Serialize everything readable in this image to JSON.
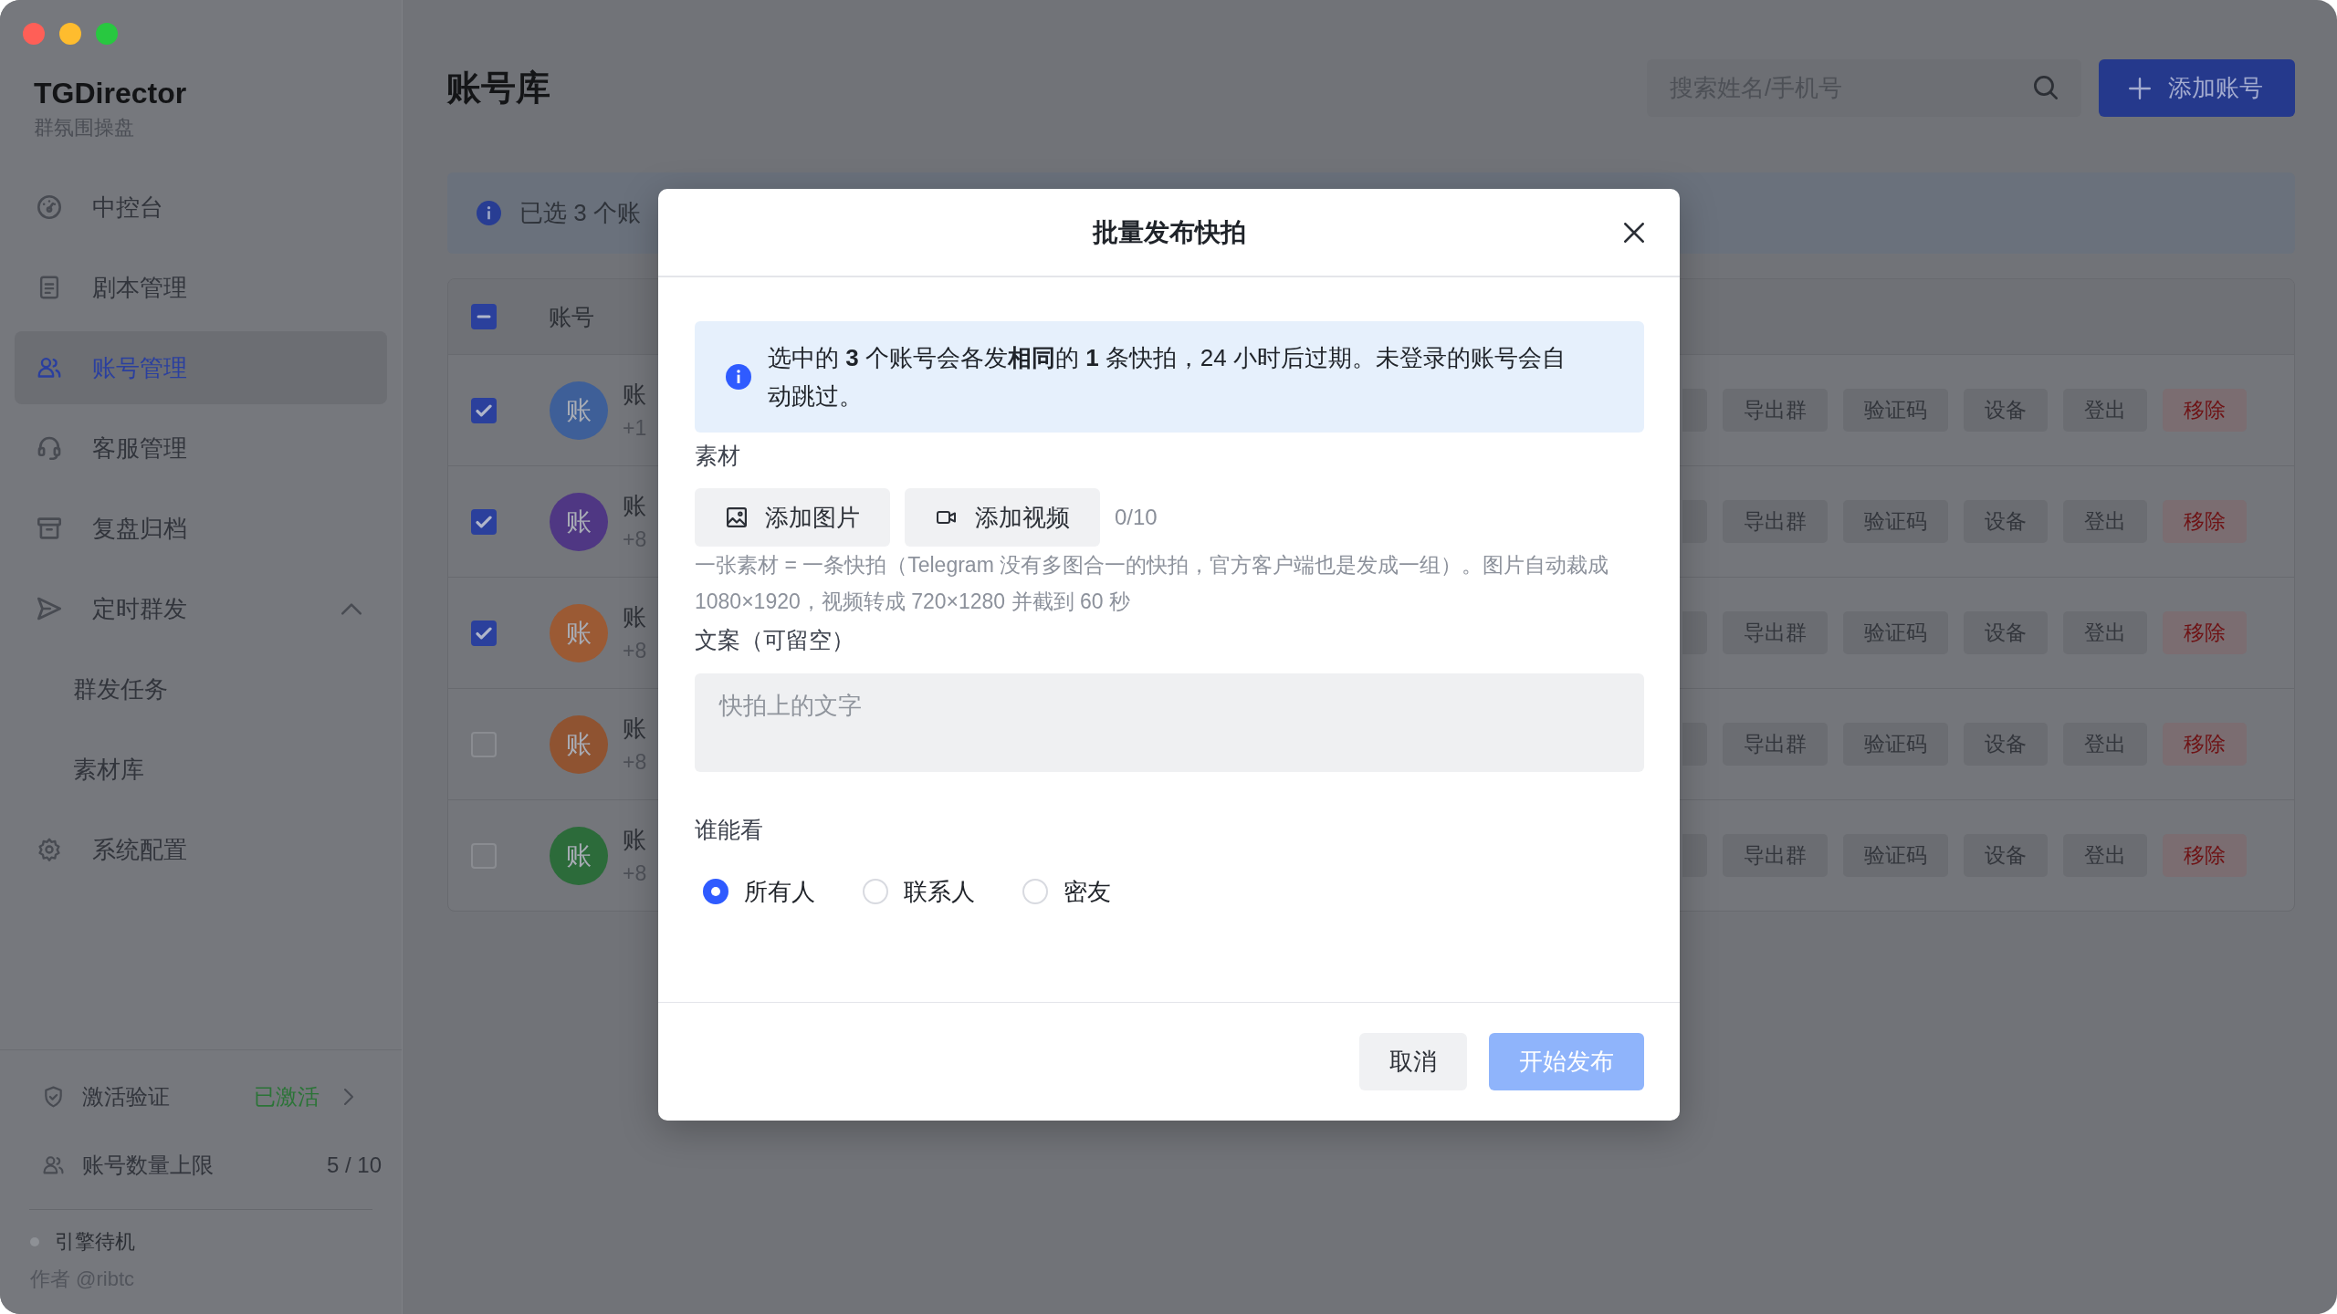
{
  "window": {
    "controls": [
      {
        "color": "#ff5f57"
      },
      {
        "color": "#febc2e"
      },
      {
        "color": "#28c840"
      }
    ]
  },
  "sidebar": {
    "brand": {
      "title": "TGDirector",
      "subtitle": "群氛围操盘"
    },
    "nav": [
      {
        "label": "中控台",
        "selected": false
      },
      {
        "label": "剧本管理",
        "selected": false
      },
      {
        "label": "账号管理",
        "selected": true
      },
      {
        "label": "客服管理",
        "selected": false
      },
      {
        "label": "复盘归档",
        "selected": false
      },
      {
        "label": "定时群发",
        "selected": false,
        "expanded": true,
        "children": [
          {
            "label": "群发任务",
            "selected": false
          },
          {
            "label": "素材库",
            "selected": false
          }
        ]
      },
      {
        "label": "系统配置",
        "selected": false
      }
    ],
    "activation": {
      "label": "激活验证",
      "status": "已激活"
    },
    "quota": {
      "label": "账号数量上限",
      "value": "5 / 10"
    },
    "engine": {
      "label": "引擎待机",
      "running": false
    },
    "author": "作者 @ribtc"
  },
  "page": {
    "title": "账号库",
    "search": {
      "placeholder": "搜索姓名/手机号"
    },
    "add_button": "添加账号"
  },
  "selection_banner": "已选 3 个账",
  "table": {
    "select_all": {
      "indeterminate": true
    },
    "columns": [
      "账号"
    ],
    "rows": [
      {
        "checked": true,
        "avatar": "账",
        "color": "#3e5f98",
        "name": "账",
        "phone": "+1",
        "actions": [
          {
            "kind": "clipped"
          },
          {
            "kind": "default",
            "label": "导出群"
          },
          {
            "kind": "default",
            "label": "验证码"
          },
          {
            "kind": "default",
            "label": "设备"
          },
          {
            "kind": "default",
            "label": "登出"
          },
          {
            "kind": "danger",
            "label": "移除"
          }
        ]
      },
      {
        "checked": true,
        "avatar": "账",
        "color": "#4f3783",
        "name": "账",
        "phone": "+8",
        "actions": [
          {
            "kind": "clipped"
          },
          {
            "kind": "default",
            "label": "导出群"
          },
          {
            "kind": "default",
            "label": "验证码"
          },
          {
            "kind": "default",
            "label": "设备"
          },
          {
            "kind": "default",
            "label": "登出"
          },
          {
            "kind": "danger",
            "label": "移除"
          }
        ]
      },
      {
        "checked": true,
        "avatar": "账",
        "color": "#9b5a34",
        "name": "账",
        "phone": "+8",
        "actions": [
          {
            "kind": "clipped"
          },
          {
            "kind": "default",
            "label": "导出群"
          },
          {
            "kind": "default",
            "label": "验证码"
          },
          {
            "kind": "default",
            "label": "设备"
          },
          {
            "kind": "default",
            "label": "登出"
          },
          {
            "kind": "danger",
            "label": "移除"
          }
        ]
      },
      {
        "checked": false,
        "avatar": "账",
        "color": "#8f5331",
        "name": "账",
        "phone": "+8",
        "actions": [
          {
            "kind": "clipped"
          },
          {
            "kind": "default",
            "label": "导出群"
          },
          {
            "kind": "default",
            "label": "验证码"
          },
          {
            "kind": "default",
            "label": "设备"
          },
          {
            "kind": "default",
            "label": "登出"
          },
          {
            "kind": "danger",
            "label": "移除"
          }
        ]
      },
      {
        "checked": false,
        "avatar": "账",
        "color": "#2c6b3a",
        "name": "账",
        "phone": "+8",
        "actions": [
          {
            "kind": "clipped"
          },
          {
            "kind": "default",
            "label": "导出群"
          },
          {
            "kind": "default",
            "label": "验证码"
          },
          {
            "kind": "default",
            "label": "设备"
          },
          {
            "kind": "default",
            "label": "登出"
          },
          {
            "kind": "danger",
            "label": "移除"
          }
        ]
      }
    ]
  },
  "dialog": {
    "title": "批量发布快拍",
    "alert": "选中的 **3** 个账号会各发**相同**的 **1** 条快拍，24 小时后过期。未登录的账号会自动跳过。",
    "media": {
      "label": "素材",
      "buttons": [
        {
          "kind": "image",
          "label": "添加图片"
        },
        {
          "kind": "video",
          "label": "添加视频"
        }
      ],
      "count": "0/10",
      "hint": "一张素材 = 一条快拍（Telegram 没有多图合一的快拍，官方客户端也是发成一组）。图片自动裁成 1080×1920，视频转成 720×1280 并截到 60 秒"
    },
    "caption": {
      "label": "文案（可留空）",
      "placeholder": "快拍上的文字"
    },
    "audience": {
      "label": "谁能看",
      "options": [
        {
          "label": "所有人",
          "selected": true
        },
        {
          "label": "联系人",
          "selected": false
        },
        {
          "label": "密友",
          "selected": false
        }
      ]
    },
    "buttons": [
      {
        "kind": "secondary",
        "label": "取消",
        "disabled": false
      },
      {
        "kind": "primary",
        "label": "开始发布",
        "disabled": true
      }
    ]
  }
}
